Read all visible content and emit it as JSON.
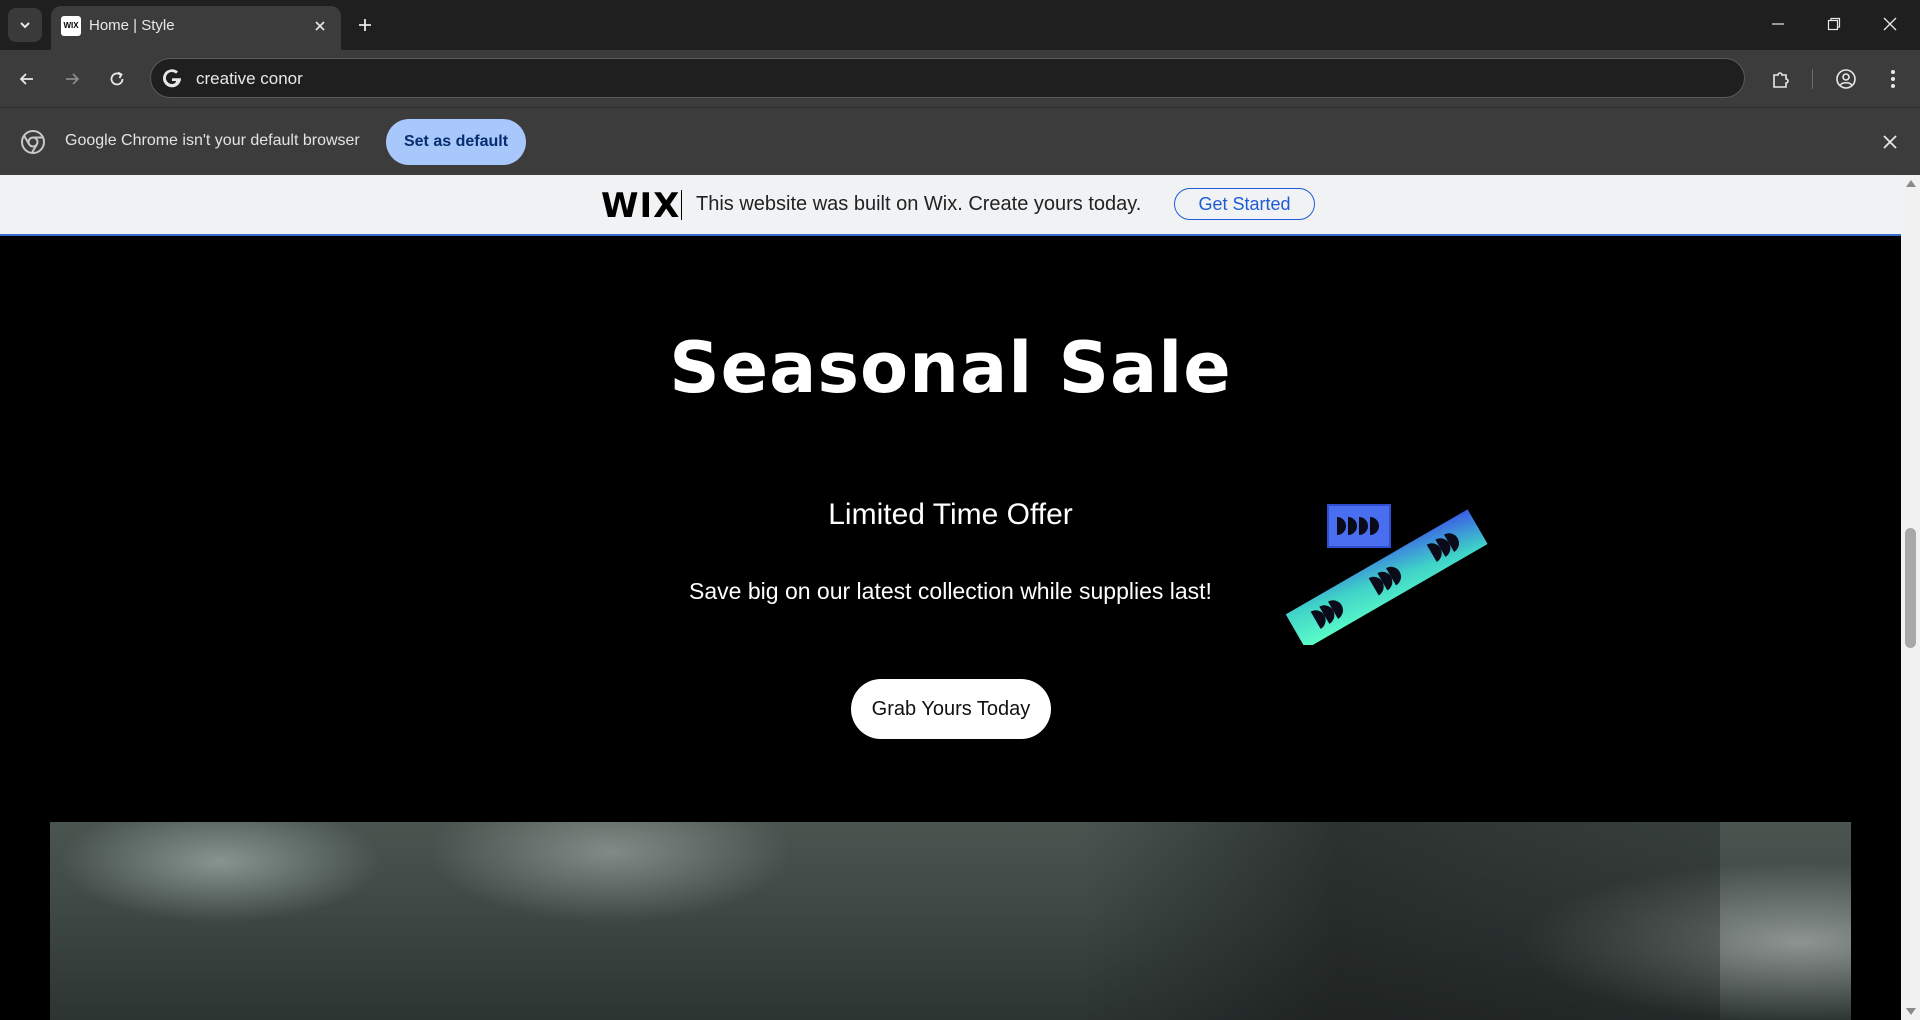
{
  "browser": {
    "tab": {
      "title": "Home | Style",
      "favicon_text": "WIX"
    },
    "omnibox": {
      "value": "creative conor"
    },
    "infobar": {
      "message": "Google Chrome isn't your default browser",
      "button": "Set as default"
    }
  },
  "wix_banner": {
    "logo": "WIX",
    "text": "This website was built on Wix. Create yours today.",
    "button": "Get Started"
  },
  "hero": {
    "title": "Seasonal Sale",
    "subtitle": "Limited Time Offer",
    "description": "Save big on our latest collection while supplies last!",
    "cta": "Grab Yours Today"
  },
  "colors": {
    "page_bg": "#000000",
    "accent_blue": "#1f5bd6",
    "chrome_button": "#a8c7fa",
    "decor_gradient_start": "#5dffc8",
    "decor_gradient_end": "#3b5ce8"
  }
}
